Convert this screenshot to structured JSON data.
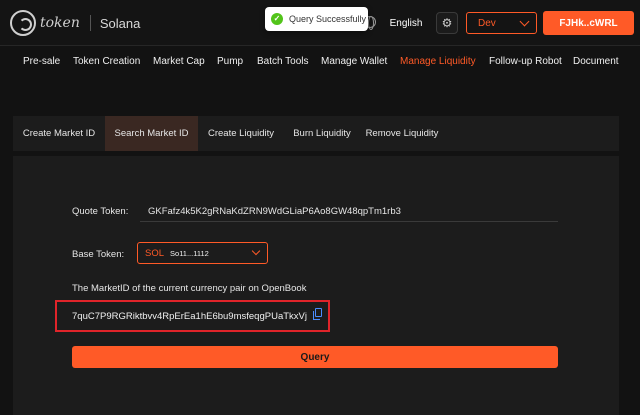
{
  "header": {
    "logo_text": "token",
    "chain": "Solana",
    "toast": "Query Successfully",
    "language": "English",
    "network": "Dev",
    "wallet": "FJHk..cWRL"
  },
  "nav": {
    "items": [
      {
        "label": "Pre-sale"
      },
      {
        "label": "Token Creation"
      },
      {
        "label": "Market Cap"
      },
      {
        "label": "Pump"
      },
      {
        "label": "Batch Tools"
      },
      {
        "label": "Manage Wallet"
      },
      {
        "label": "Manage Liquidity",
        "active": true
      },
      {
        "label": "Follow-up Robot"
      },
      {
        "label": "Document"
      }
    ]
  },
  "tabs": [
    {
      "label": "Create Market ID"
    },
    {
      "label": "Search Market ID",
      "active": true
    },
    {
      "label": "Create Liquidity"
    },
    {
      "label": "Burn Liquidity"
    },
    {
      "label": "Remove Liquidity"
    }
  ],
  "form": {
    "quote_label": "Quote Token:",
    "quote_value": "GKFafz4k5K2gRNaKdZRN9WdGLiaP6Ao8GW48qpTm1rb3",
    "base_label": "Base Token:",
    "base_symbol": "SOL",
    "base_address": "So11...1112",
    "marketid_label": "The MarketID of the current currency pair on OpenBook",
    "marketid_value": "7quC7P9RGRiktbvv4RpErEa1hE6bu9msfeqgPUaTkxVj",
    "query_button": "Query"
  },
  "colors": {
    "accent": "#ff5a27",
    "highlight_border": "#e0242a",
    "success": "#52c41a"
  }
}
